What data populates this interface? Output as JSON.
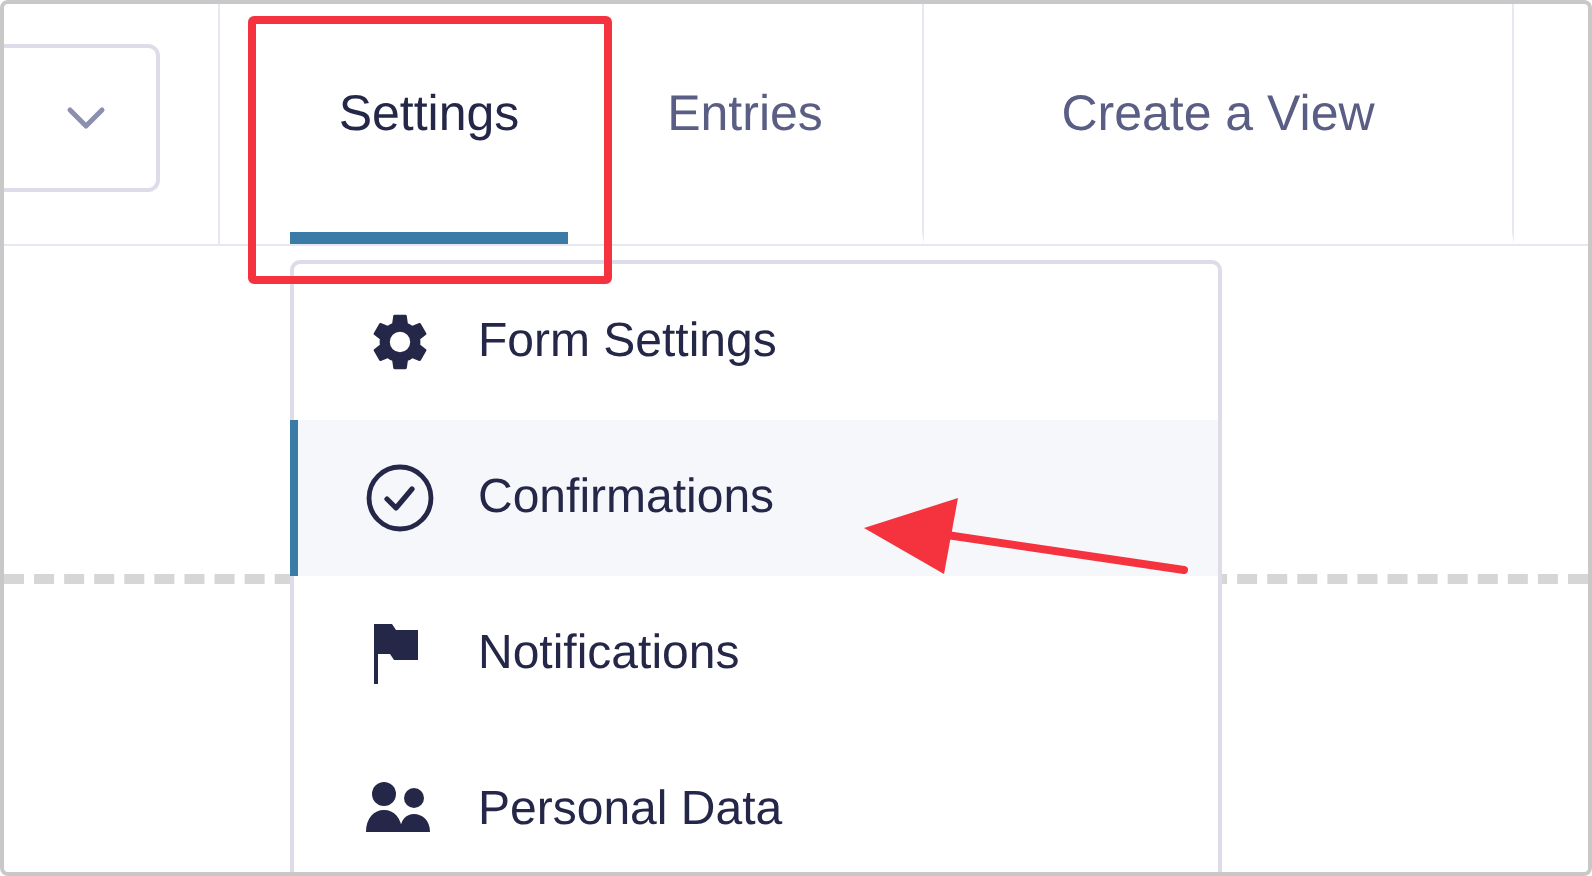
{
  "tabs": [
    {
      "label": "Settings",
      "selected": true
    },
    {
      "label": "Entries",
      "selected": false
    },
    {
      "label": "Create a View",
      "selected": false
    }
  ],
  "settings_menu": {
    "items": [
      {
        "kind": "gear",
        "label": "Form Settings",
        "selected": false
      },
      {
        "kind": "check",
        "label": "Confirmations",
        "selected": true
      },
      {
        "kind": "flag",
        "label": "Notifications",
        "selected": false
      },
      {
        "kind": "people",
        "label": "Personal Data",
        "selected": false
      }
    ]
  }
}
